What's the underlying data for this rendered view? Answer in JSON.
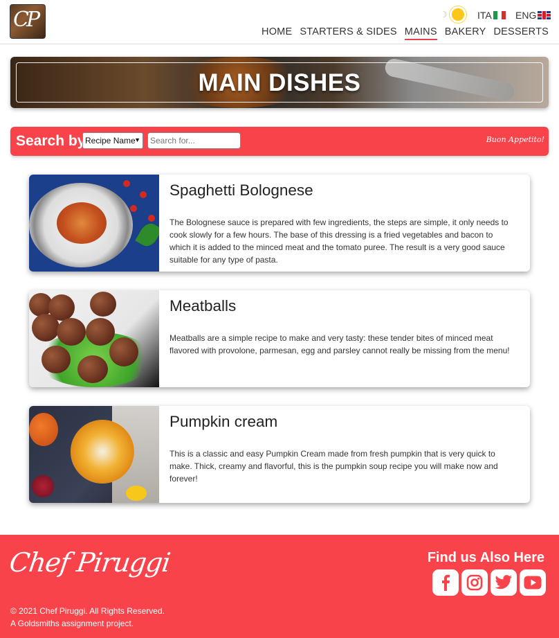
{
  "header": {
    "logo_text": "CP",
    "theme_moon": "☽",
    "languages": [
      {
        "code": "ITA",
        "flag": "flag-it-icon"
      },
      {
        "code": "ENG",
        "flag": "flag-uk-icon"
      }
    ],
    "nav": [
      {
        "label": "HOME",
        "active": false
      },
      {
        "label": "STARTERS & SIDES",
        "active": false
      },
      {
        "label": "MAINS",
        "active": true
      },
      {
        "label": "BAKERY",
        "active": false
      },
      {
        "label": "DESSERTS",
        "active": false
      }
    ]
  },
  "banner": {
    "title": "MAIN DISHES"
  },
  "search": {
    "label": "Search by",
    "select_value": "Recipe Name",
    "placeholder": "Search for...",
    "signature": "Buon Appetito!"
  },
  "recipes": [
    {
      "title": "Spaghetti Bolognese",
      "description": "The Bolognese sauce is prepared with few ingredients, the steps are simple, it only needs to cook slowly for a few hours. The base of this dressing is a fried vegetables and bacon to which it is added to the minced meat and the tomato puree. The result is a very good sauce suitable for any type of pasta."
    },
    {
      "title": "Meatballs",
      "description": "Meatballs are a simple recipe to make and very tasty: these tender bites of minced meat flavored with provolone, parmesan, egg and parsley cannot really be missing from the menu!"
    },
    {
      "title": "Pumpkin cream",
      "description": "This is a classic and easy Pumpkin Cream made from fresh pumpkin that is very quick to make. Thick, creamy and flavorful, this is the pumpkin soup recipe you will make now and forever!"
    }
  ],
  "footer": {
    "signature": "Chef Piruggi",
    "copyright": "© 2021 Chef Piruggi. All Rights Reserved.",
    "note": "A Goldsmiths assignment project.",
    "find_us": "Find us Also Here",
    "socials": [
      {
        "name": "facebook-icon",
        "glyph": "f"
      },
      {
        "name": "instagram-icon",
        "glyph": "◎"
      },
      {
        "name": "twitter-icon",
        "glyph": "🐦"
      },
      {
        "name": "youtube-icon",
        "glyph": "▶"
      }
    ]
  },
  "colors": {
    "accent": "#f9434b"
  }
}
